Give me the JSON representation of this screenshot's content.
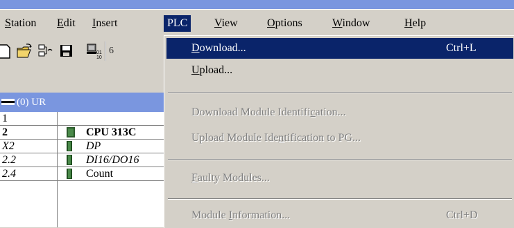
{
  "menubar": {
    "items": [
      {
        "label": "Station",
        "key": "S",
        "rest": "tation"
      },
      {
        "label": "Edit",
        "key": "E",
        "rest": "dit"
      },
      {
        "label": "Insert",
        "key": "I",
        "rest": "nsert"
      },
      {
        "label": "PLC",
        "key": "",
        "rest": "PLC"
      },
      {
        "label": "View",
        "key": "V",
        "rest": "iew"
      },
      {
        "label": "Options",
        "key": "O",
        "rest": "ptions"
      },
      {
        "label": "Window",
        "key": "W",
        "rest": "indow"
      },
      {
        "label": "Help",
        "key": "H",
        "rest": "elp"
      }
    ]
  },
  "toolbar": {
    "partial_label": "6"
  },
  "station": {
    "title": "(0) UR",
    "rows": [
      {
        "slot": "1",
        "module": ""
      },
      {
        "slot": "2",
        "module": "CPU 313C"
      },
      {
        "slot": "X2",
        "module": "DP"
      },
      {
        "slot": "2.2",
        "module": "DI16/DO16"
      },
      {
        "slot": "2.4",
        "module": "Count"
      }
    ]
  },
  "plc_menu": {
    "items": [
      {
        "pre": "",
        "key": "D",
        "post": "ownload...",
        "shortcut": "Ctrl+L",
        "state": "highlighted"
      },
      {
        "pre": "",
        "key": "U",
        "post": "pload...",
        "shortcut": "",
        "state": "enabled"
      },
      {
        "pre": "Download Module Identifi",
        "key": "c",
        "post": "ation...",
        "shortcut": "",
        "state": "disabled"
      },
      {
        "pre": "Upload Module Ide",
        "key": "n",
        "post": "tification to PG...",
        "shortcut": "",
        "state": "disabled"
      },
      {
        "pre": "",
        "key": "F",
        "post": "aulty Modules...",
        "shortcut": "",
        "state": "disabled"
      },
      {
        "pre": "Module ",
        "key": "I",
        "post": "nformation...",
        "shortcut": "Ctrl+D",
        "state": "disabled"
      }
    ]
  },
  "colors": {
    "menu_bg": "#d4d0c8",
    "highlight": "#0a246a",
    "title_bar": "#7a96df",
    "disabled_text": "#808080"
  }
}
